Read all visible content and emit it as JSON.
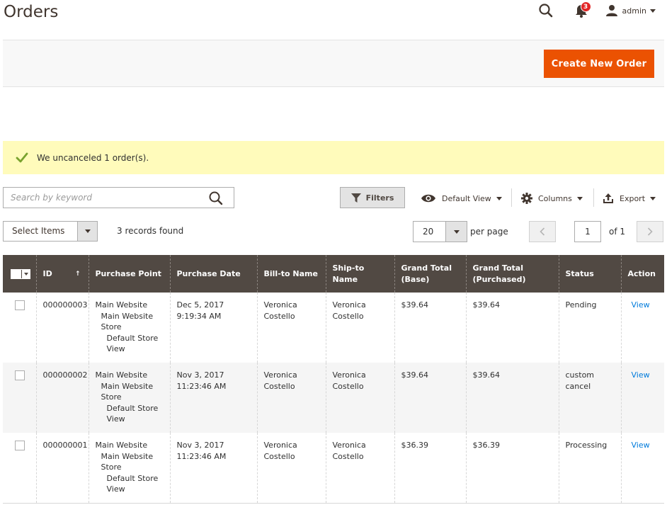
{
  "page": {
    "title": "Orders"
  },
  "header": {
    "notifications_count": "3",
    "user_name": "admin"
  },
  "actions": {
    "create_label": "Create New Order"
  },
  "message": {
    "text": "We uncanceled 1 order(s)."
  },
  "search": {
    "placeholder": "Search by keyword",
    "value": ""
  },
  "toolbar": {
    "filters_label": "Filters",
    "view_label": "Default View",
    "columns_label": "Columns",
    "export_label": "Export"
  },
  "mass_actions": {
    "label": "Select Items"
  },
  "records_found": "3 records found",
  "pagination": {
    "per_page_value": "20",
    "per_page_label": "per page",
    "current_page": "1",
    "total_label": "of 1"
  },
  "colors": {
    "accent": "#eb5202",
    "header_bg": "#514943",
    "link": "#007bdb",
    "message_bg": "#fffbbb"
  },
  "table": {
    "columns": [
      {
        "label": "ID",
        "sort": "↑"
      },
      {
        "label": "Purchase Point"
      },
      {
        "label": "Purchase Date"
      },
      {
        "label": "Bill-to Name"
      },
      {
        "label": "Ship-to Name"
      },
      {
        "label": "Grand Total (Base)"
      },
      {
        "label": "Grand Total (Purchased)"
      },
      {
        "label": "Status"
      },
      {
        "label": "Action"
      }
    ],
    "rows": [
      {
        "id": "000000003",
        "purchase_point": {
          "website": "Main Website",
          "store": "Main Website Store",
          "view": "Default Store View"
        },
        "purchase_date": "Dec 5, 2017 9:19:34 AM",
        "bill_to": "Veronica Costello",
        "ship_to": "Veronica Costello",
        "total_base": "$39.64",
        "total_purchased": "$39.64",
        "status": "Pending",
        "action": "View"
      },
      {
        "id": "000000002",
        "purchase_point": {
          "website": "Main Website",
          "store": "Main Website Store",
          "view": "Default Store View"
        },
        "purchase_date": "Nov 3, 2017 11:23:46 AM",
        "bill_to": "Veronica Costello",
        "ship_to": "Veronica Costello",
        "total_base": "$39.64",
        "total_purchased": "$39.64",
        "status": "custom cancel",
        "action": "View"
      },
      {
        "id": "000000001",
        "purchase_point": {
          "website": "Main Website",
          "store": "Main Website Store",
          "view": "Default Store View"
        },
        "purchase_date": "Nov 3, 2017 11:23:46 AM",
        "bill_to": "Veronica Costello",
        "ship_to": "Veronica Costello",
        "total_base": "$36.39",
        "total_purchased": "$36.39",
        "status": "Processing",
        "action": "View"
      }
    ]
  }
}
